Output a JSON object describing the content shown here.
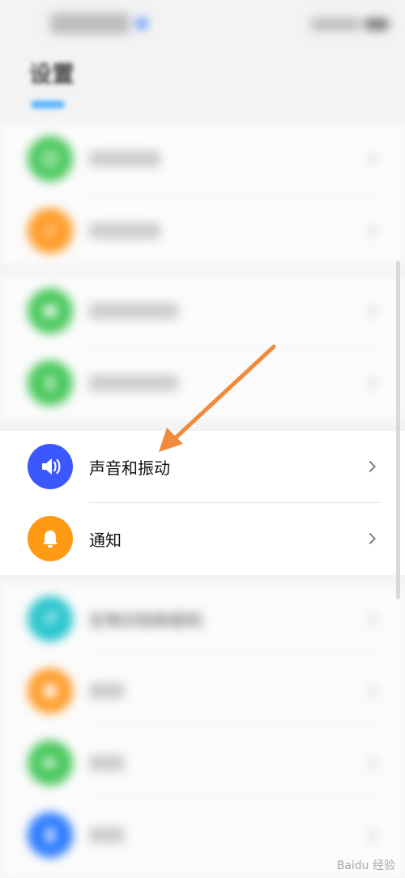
{
  "header": {
    "title": "设置"
  },
  "settings_groups": [
    {
      "blurred": true,
      "items": [
        {
          "icon": "phone-icon",
          "color": "#4cc95f",
          "placeholder_width": 88
        },
        {
          "icon": "link-icon",
          "color": "#ff9d2d",
          "placeholder_width": 88
        }
      ]
    },
    {
      "blurred": true,
      "items": [
        {
          "icon": "wallpaper-icon",
          "color": "#4cc95f",
          "placeholder_width": 110
        },
        {
          "icon": "display-icon",
          "color": "#4cc95f",
          "placeholder_width": 110
        }
      ]
    },
    {
      "blurred": false,
      "items": [
        {
          "label": "声音和振动",
          "icon": "speaker-icon",
          "color": "#3b58ff"
        },
        {
          "label": "通知",
          "icon": "bell-icon",
          "color": "#ff9a14"
        }
      ]
    },
    {
      "blurred": true,
      "items": [
        {
          "label": "生物识别和密码",
          "icon": "key-icon",
          "color": "#2cc6cf"
        },
        {
          "icon": "apps-icon",
          "color": "#ff9d2d",
          "placeholder_width": 44
        },
        {
          "icon": "battery-icon",
          "color": "#4cc95f",
          "placeholder_width": 44
        },
        {
          "icon": "storage-icon",
          "color": "#2e7dff",
          "placeholder_width": 44
        }
      ]
    }
  ],
  "annotation": {
    "arrow_color": "#f08a3c"
  },
  "watermark": "Baidu 经验"
}
